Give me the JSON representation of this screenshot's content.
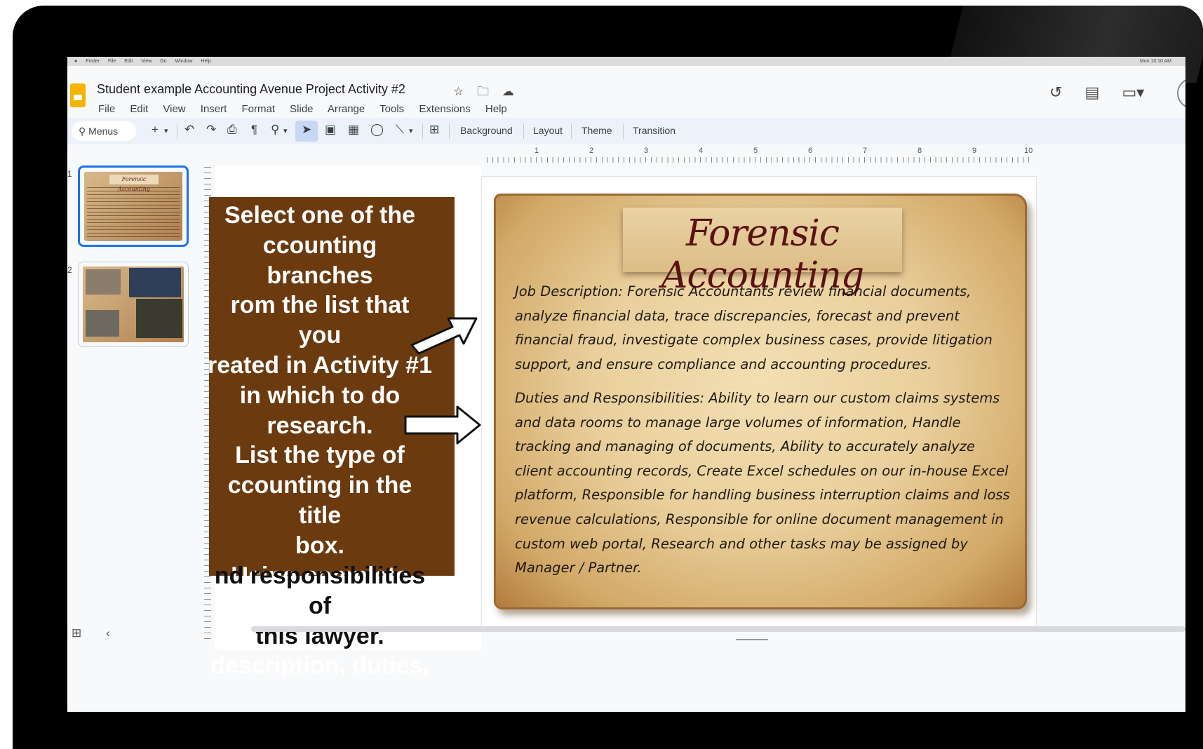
{
  "mac_menu": {
    "items": [
      "Finder",
      "File",
      "Edit",
      "View",
      "Go",
      "Window",
      "Help"
    ],
    "clock": "Mon 10:10 AM"
  },
  "document": {
    "title": "Student example  Accounting Avenue Project Activity #2",
    "title_icons": [
      "star-icon",
      "move-to-folder-icon",
      "cloud-status-icon"
    ]
  },
  "menubar": [
    "File",
    "Edit",
    "View",
    "Insert",
    "Format",
    "Slide",
    "Arrange",
    "Tools",
    "Extensions",
    "Help"
  ],
  "header_actions": [
    "version-history-icon",
    "comments-icon",
    "meet-icon"
  ],
  "toolbar": {
    "search_label": "Menus",
    "buttons": [
      "Background",
      "Layout",
      "Theme",
      "Transition"
    ]
  },
  "filmstrip": {
    "slides": [
      {
        "number": "1",
        "thumb_title": "Forensic Accounting"
      },
      {
        "number": "2"
      }
    ]
  },
  "ruler": {
    "marks": [
      "1",
      "2",
      "3",
      "4",
      "5",
      "6",
      "7",
      "8",
      "9",
      "10"
    ]
  },
  "instructions": {
    "text_on_brown": "Select one of the\nccounting branches\nrom the list that you\nreated in Activity #1\nin which to do\nresearch.\nList the type of\nccounting  in the title\nbox.\nUsing complete\nsentences, list a job\ndescription, duties,",
    "text_below": "nd responsibilities of\nthis lawyer.",
    "box_color": "#6b3a0f"
  },
  "slide": {
    "title": "Forensic Accounting",
    "job_description": "Job Description: Forensic Accountants review financial documents, analyze financial data, trace discrepancies, forecast and prevent financial fraud, investigate complex business cases, provide litigation support, and ensure compliance and accounting procedures.",
    "duties": "Duties and Responsibilities: Ability to learn our custom claims systems and data rooms to manage large volumes of information, Handle tracking and managing of documents, Ability to accurately analyze client accounting records, Create Excel schedules on our in-house Excel platform, Responsible for handling business interruption claims and loss revenue calculations, Responsible for online document management in custom web portal, Research and other tasks may be assigned by Manager / Partner.",
    "title_color": "#5a1212"
  }
}
